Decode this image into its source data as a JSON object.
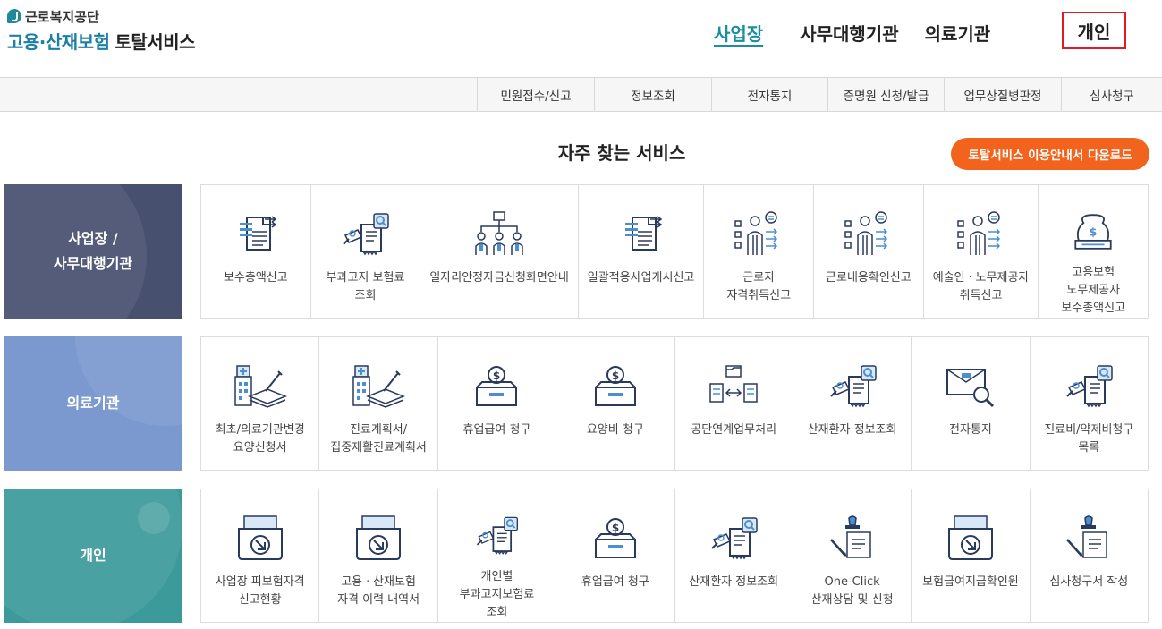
{
  "header": {
    "org_name": "근로복지공단",
    "service_name_a": "고용·산재보험",
    "service_name_b": "토탈서비스",
    "nav": {
      "business": "사업장",
      "agency": "사무대행기관",
      "medical": "의료기관",
      "personal": "개인"
    }
  },
  "subnav": {
    "items": [
      "민원접수/신고",
      "정보조회",
      "전자통지",
      "증명원 신청/발급",
      "업무상질병판정",
      "심사청구"
    ]
  },
  "main": {
    "title": "자주 찾는 서비스",
    "download_label": "토탈서비스 이용안내서 다운로드"
  },
  "categories": {
    "business": {
      "line1": "사업장 /",
      "line2": "사무대행기관"
    },
    "medical": {
      "line1": "의료기관"
    },
    "personal": {
      "line1": "개인"
    }
  },
  "rows": {
    "business": [
      {
        "label": "보수총액신고",
        "icon": "document-list-icon"
      },
      {
        "label": "부과고지 보험료 조회",
        "icon": "document-search-icon"
      },
      {
        "label": "일자리안정자금신청화면안내",
        "icon": "organization-icon"
      },
      {
        "label": "일괄적용사업개시신고",
        "icon": "document-list-icon"
      },
      {
        "label": "근로자 자격취득신고",
        "icon": "person-report-icon"
      },
      {
        "label": "근로내용확인신고",
        "icon": "person-report-icon"
      },
      {
        "label": "예술인ㆍ노무제공자 취득신고",
        "icon": "person-report-icon"
      },
      {
        "label": "고용보험 노무제공자 보수총액신고",
        "icon": "money-bag-icon"
      }
    ],
    "medical": [
      {
        "label": "최초/의료기관변경 요양신청서",
        "icon": "hospital-form-icon"
      },
      {
        "label": "진료계획서/집중재활진료계획서",
        "icon": "hospital-form-icon"
      },
      {
        "label": "휴업급여 청구",
        "icon": "coin-box-icon"
      },
      {
        "label": "요양비 청구",
        "icon": "coin-box-icon"
      },
      {
        "label": "공단연계업무처리",
        "icon": "exchange-docs-icon"
      },
      {
        "label": "산재환자 정보조회",
        "icon": "document-search-icon"
      },
      {
        "label": "전자통지",
        "icon": "mail-search-icon"
      },
      {
        "label": "진료비/약제비청구 목록",
        "icon": "document-search-icon"
      }
    ],
    "personal": [
      {
        "label": "사업장 피보험자격 신고현황",
        "icon": "tray-download-icon"
      },
      {
        "label": "고용ㆍ산재보험 자격 이력 내역서",
        "icon": "tray-download-icon"
      },
      {
        "label": "개인별 부과고지보험료 조회",
        "icon": "document-search-icon"
      },
      {
        "label": "휴업급여 청구",
        "icon": "coin-box-icon"
      },
      {
        "label": "산재환자 정보조회",
        "icon": "document-search-icon"
      },
      {
        "label": "One-Click 산재상담 및 신청",
        "icon": "stamp-pen-icon"
      },
      {
        "label": "보험급여지급확인원",
        "icon": "tray-download-icon"
      },
      {
        "label": "심사청구서 작성",
        "icon": "stamp-pen-icon"
      }
    ]
  },
  "colors": {
    "accent": "#1b8ea0",
    "download_button": "#f2641d",
    "highlight_border": "#e11b22",
    "category_business": "#48506f",
    "category_medical": "#7b98cf",
    "category_personal": "#3d9a9a",
    "icon_navy": "#2a3a5c",
    "icon_blue": "#4a8fd0"
  }
}
